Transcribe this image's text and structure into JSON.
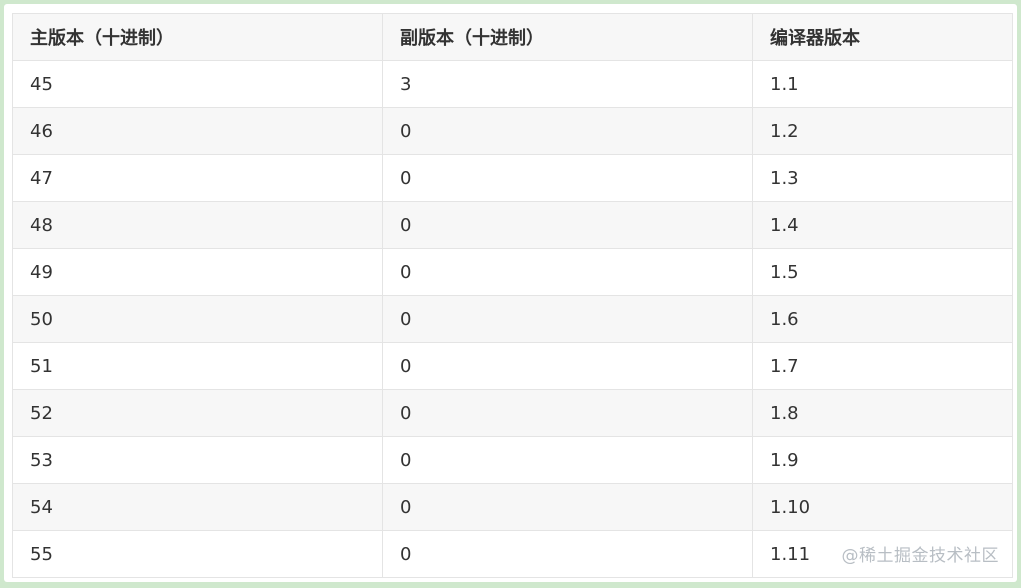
{
  "table": {
    "headers": [
      "主版本（十进制）",
      "副版本（十进制）",
      "编译器版本"
    ],
    "rows": [
      [
        "45",
        "3",
        "1.1"
      ],
      [
        "46",
        "0",
        "1.2"
      ],
      [
        "47",
        "0",
        "1.3"
      ],
      [
        "48",
        "0",
        "1.4"
      ],
      [
        "49",
        "0",
        "1.5"
      ],
      [
        "50",
        "0",
        "1.6"
      ],
      [
        "51",
        "0",
        "1.7"
      ],
      [
        "52",
        "0",
        "1.8"
      ],
      [
        "53",
        "0",
        "1.9"
      ],
      [
        "54",
        "0",
        "1.10"
      ],
      [
        "55",
        "0",
        "1.11"
      ]
    ]
  },
  "watermark": "@稀土掘金技术社区",
  "colors": {
    "page_border": "#cfe8cd",
    "header_bg": "#f7f7f7",
    "stripe_bg": "#f7f7f7",
    "grid_line": "#e4e4e4",
    "text": "#333333",
    "watermark": "#b8bec4"
  }
}
